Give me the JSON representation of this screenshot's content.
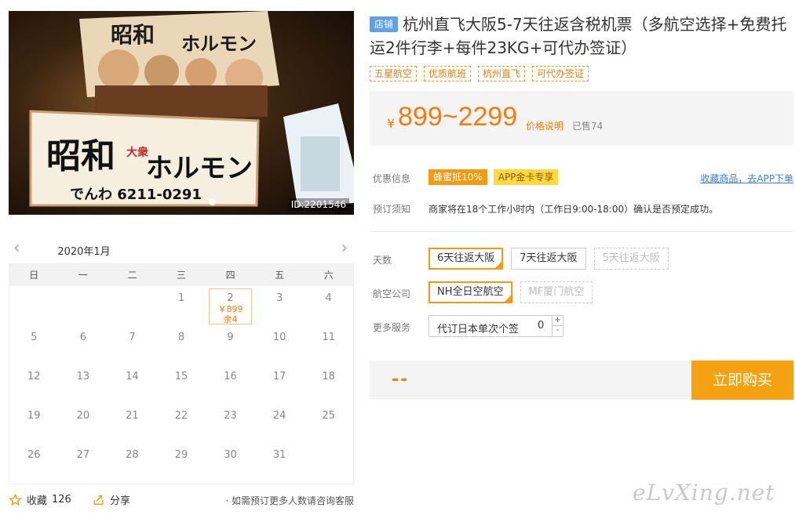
{
  "photo": {
    "id_text": "ID:2201546",
    "sign_main": "昭和",
    "sign_small": "大衆",
    "sign_kana": "ホルモン",
    "sign_phone": "でんわ 6211-0291"
  },
  "calendar": {
    "month": "2020年1月",
    "weekdays": [
      "日",
      "一",
      "二",
      "三",
      "四",
      "五",
      "六"
    ],
    "available_day": {
      "day": "2",
      "price": "￥899",
      "stock": "余4"
    }
  },
  "bottom": {
    "fav_label": "收藏",
    "fav_count": "126",
    "share_label": "分享",
    "note": "· 如需预订更多人数请咨询客服"
  },
  "product": {
    "shop_badge": "店铺",
    "title": "杭州直飞大阪5-7天往返含税机票（多航空选择+免费托运2件行李+每件23KG+可代办签证）",
    "tags": [
      "五星航空",
      "优质航班",
      "杭州直飞",
      "可代办签证"
    ]
  },
  "price": {
    "currency": "¥",
    "range": "899~2299",
    "explain": "价格说明",
    "sold": "已售74"
  },
  "promo": {
    "label": "优惠信息",
    "badge1": "蜂蜜抵10%",
    "badge2": "APP金卡专享",
    "app_link": "收藏商品，去APP下单"
  },
  "booking": {
    "label": "预订须知",
    "text": "商家将在18个工作小时内（工作日9:00-18:00）确认是否预定成功。"
  },
  "days": {
    "label": "天数",
    "options": [
      "6天往返大阪",
      "7天往返大阪",
      "5天往返大阪"
    ]
  },
  "airline": {
    "label": "航空公司",
    "options": [
      "NH全日空航空",
      "MF厦门航空"
    ]
  },
  "service": {
    "label": "更多服务",
    "name": "代订日本单次个签",
    "qty": "0",
    "plus": "+",
    "minus": "-"
  },
  "buy": {
    "price_placeholder": "--",
    "button": "立即购买"
  },
  "watermark": "eLvXing.net",
  "colors": {
    "accent": "#f49a12",
    "price": "#f27d0c",
    "link": "#3b7ed8",
    "shop_badge": "#5fa0e8"
  }
}
